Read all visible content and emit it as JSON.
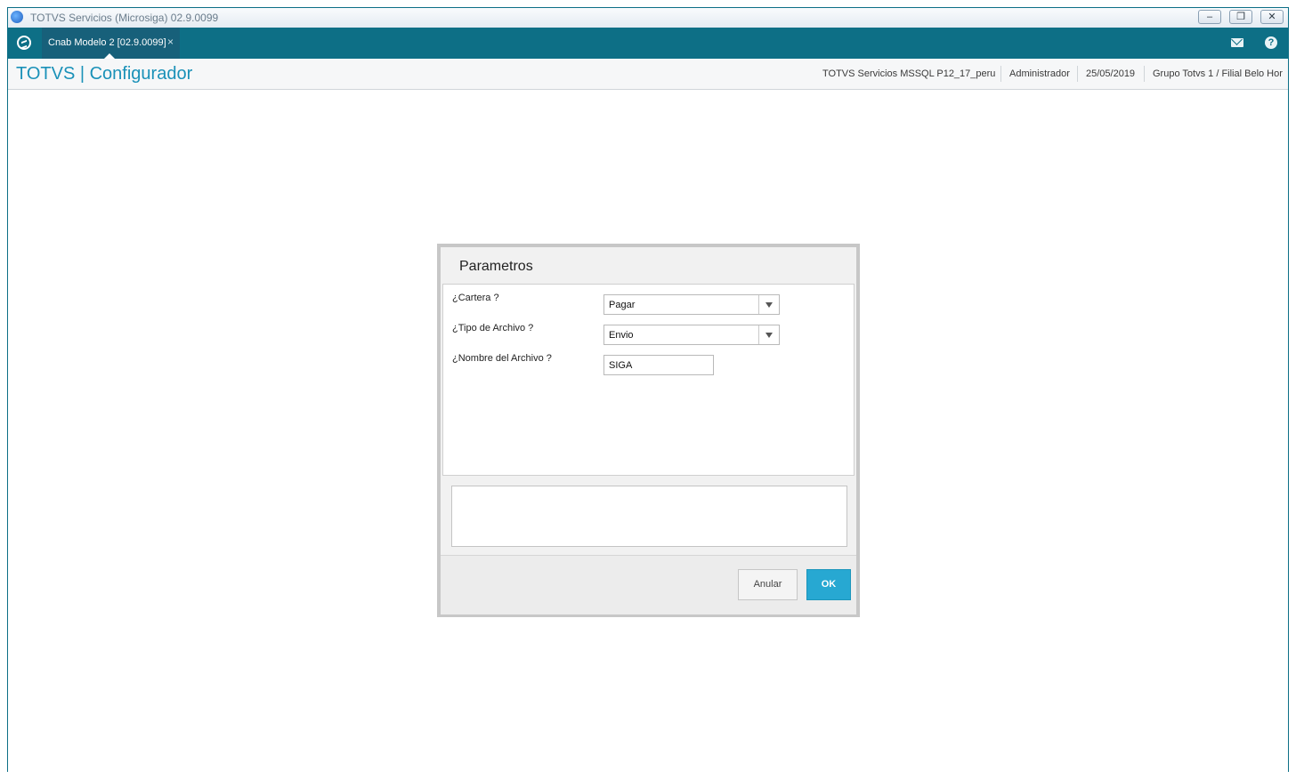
{
  "window": {
    "title": "TOTVS Servicios (Microsiga) 02.9.0099",
    "controls": {
      "minimize": "–",
      "restore": "❐",
      "close": "✕"
    }
  },
  "tabbar": {
    "home_icon": "totvs-home-icon",
    "tabs": [
      {
        "label": "Cnab Modelo 2 [02.9.0099]",
        "close": "×",
        "active": true
      }
    ],
    "mail_icon": "mail-icon",
    "help_icon": "?"
  },
  "header": {
    "app_title": "TOTVS | Configurador",
    "environment": "TOTVS Servicios MSSQL P12_17_peru",
    "user": "Administrador",
    "date": "25/05/2019",
    "company": "Grupo Totvs 1 / Filial Belo Hor"
  },
  "dialog": {
    "title": "Parametros",
    "params": [
      {
        "label": "¿Cartera ?",
        "type": "select",
        "value": "Pagar"
      },
      {
        "label": "¿Tipo de Archivo ?",
        "type": "select",
        "value": "Envio"
      },
      {
        "label": "¿Nombre del Archivo ?",
        "type": "text",
        "value": "SIGA"
      }
    ],
    "memo_text": "",
    "buttons": {
      "cancel": "Anular",
      "ok": "OK"
    }
  },
  "colors": {
    "accent": "#0d6f86",
    "title_blue": "#1a91b8",
    "ok_button": "#27a8d2"
  }
}
